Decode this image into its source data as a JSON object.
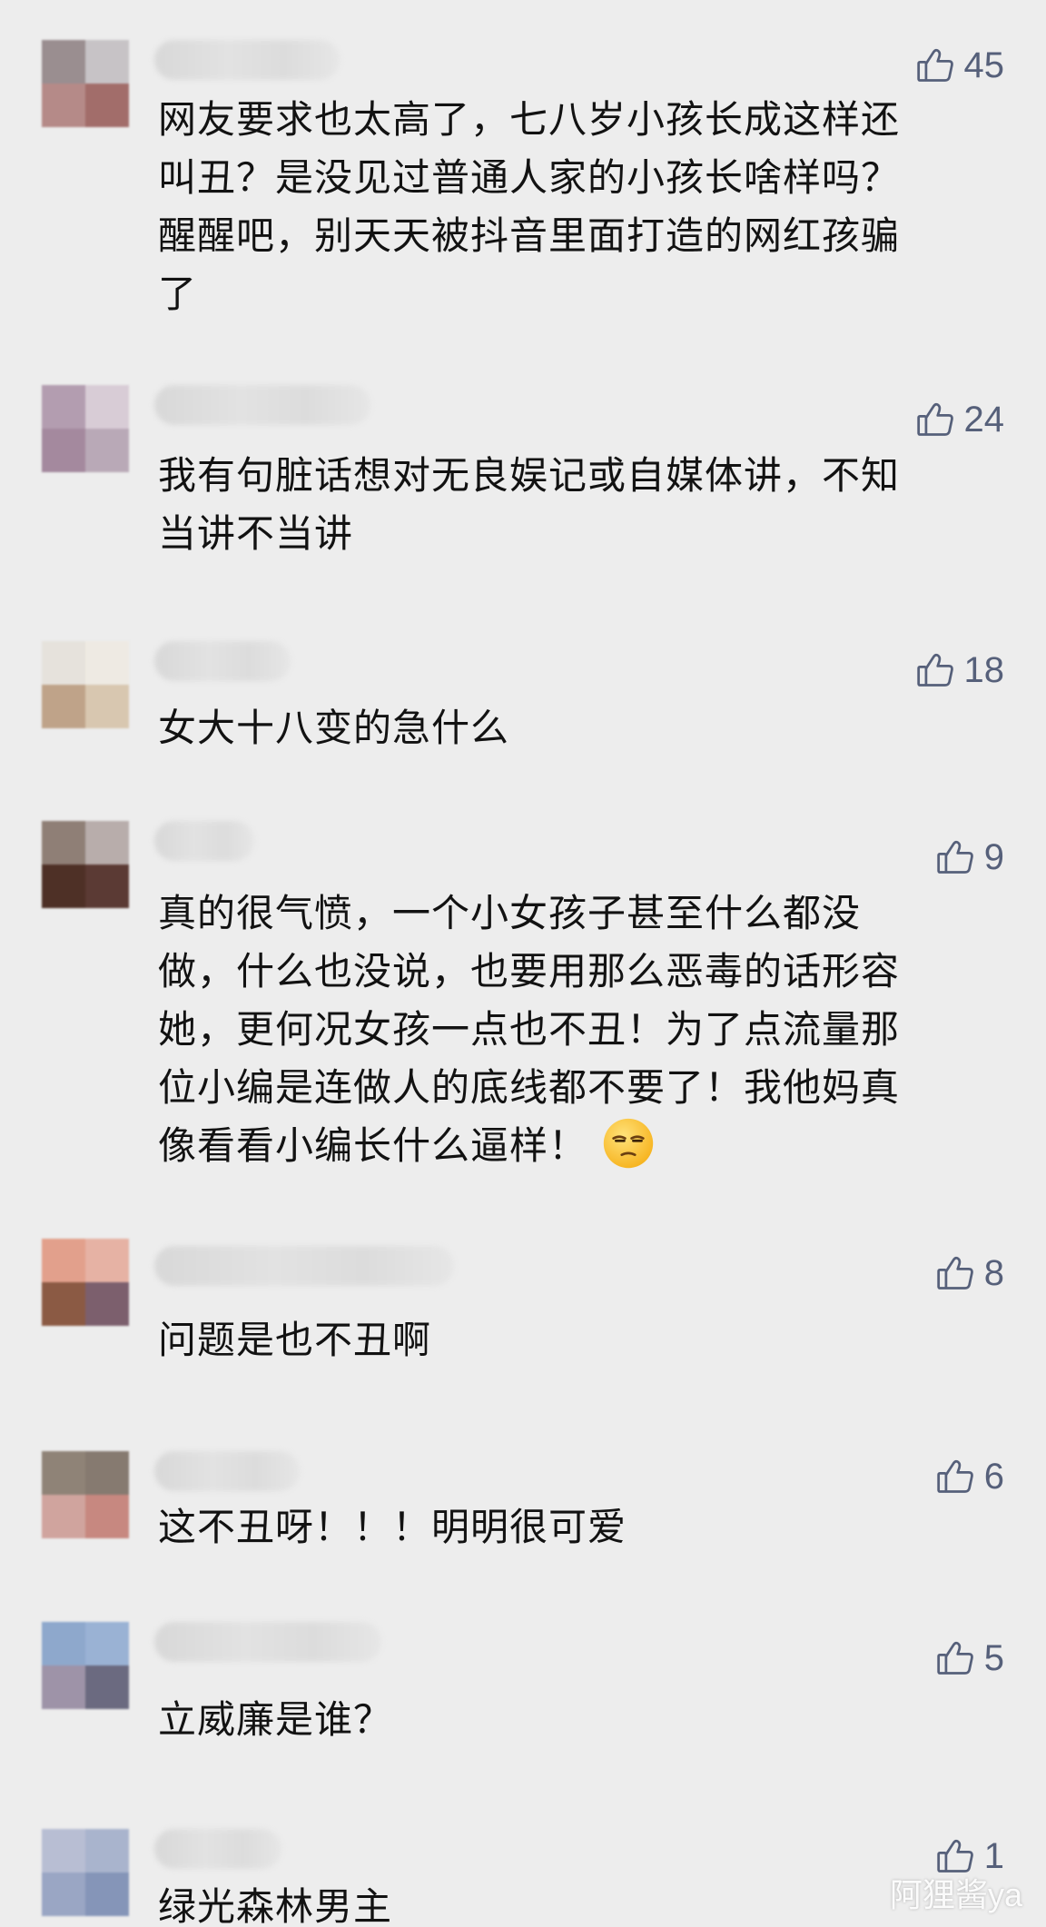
{
  "comments": [
    {
      "likes": "45",
      "text": "网友要求也太高了，七八岁小孩长成这样还\n叫丑？是没见过普通人家的小孩长啥样吗？\n醒醒吧，别天天被抖音里面打造的网红孩骗\n了",
      "avatar_colors": [
        "#9a8e90",
        "#c7c3c6",
        "#b58a88",
        "#a26d6a"
      ]
    },
    {
      "likes": "24",
      "text": "我有句脏话想对无良娱记或自媒体讲，不知\n当讲不当讲",
      "avatar_colors": [
        "#b39db0",
        "#d8ccd6",
        "#a4899e",
        "#b9a9b7"
      ]
    },
    {
      "likes": "18",
      "text": "女大十八变的急什么",
      "avatar_colors": [
        "#e6e2dc",
        "#eeeae3",
        "#bfa389",
        "#d8c7b0"
      ]
    },
    {
      "likes": "9",
      "text": "真的很气愤，一个小女孩子甚至什么都没\n做，什么也没说，也要用那么恶毒的话形容\n她，更何况女孩一点也不丑！为了点流量那\n位小编是连做人的底线都不要了！我他妈真\n像看看小编长什么逼样！",
      "emoji": true,
      "avatar_colors": [
        "#8f7f76",
        "#b8adab",
        "#4e3026",
        "#5b3a34"
      ]
    },
    {
      "likes": "8",
      "text": "问题是也不丑啊",
      "avatar_colors": [
        "#e2a08c",
        "#e6b2a4",
        "#8b5a44",
        "#7c5f6d"
      ]
    },
    {
      "likes": "6",
      "text": "这不丑呀！！！明明很可爱",
      "avatar_colors": [
        "#8f8377",
        "#867a70",
        "#d0a49e",
        "#c78880"
      ]
    },
    {
      "likes": "5",
      "text": "立威廉是谁？",
      "avatar_colors": [
        "#8ea8cc",
        "#9ab2d4",
        "#9e93a8",
        "#6b6a80"
      ]
    },
    {
      "likes": "1",
      "text": "绿光森林男主",
      "avatar_colors": [
        "#b8bed3",
        "#a9b4cd",
        "#9aa6c4",
        "#8595b8"
      ]
    }
  ],
  "watermark": "阿狸酱ya",
  "colors": {
    "background": "#ededed",
    "like_color": "#56607a",
    "text_color": "#121212"
  }
}
